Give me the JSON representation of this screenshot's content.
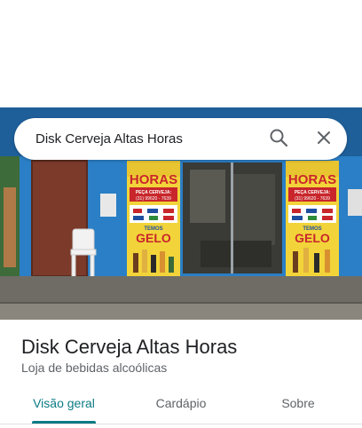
{
  "search": {
    "query": "Disk Cerveja Altas Horas"
  },
  "photo": {
    "sign_left": {
      "headline": "HORAS",
      "call_label": "PEÇA CERVEJA:",
      "phone": "(31) 99620 - 7639",
      "temos": "TEMOS",
      "gelo": "GELO"
    },
    "sign_right": {
      "headline": "HORAS",
      "call_label": "PEÇA CERVEJA:",
      "phone": "(31) 99620 - 7639",
      "temos": "TEMOS",
      "gelo": "GELO"
    },
    "colors": {
      "wall": "#2a7fc6",
      "sign_yellow": "#f2d43a",
      "sign_red": "#c8262b"
    }
  },
  "place": {
    "name": "Disk Cerveja Altas Horas",
    "category": "Loja de bebidas alcoólicas"
  },
  "tabs": [
    {
      "label": "Visão geral",
      "active": true
    },
    {
      "label": "Cardápio",
      "active": false
    },
    {
      "label": "Sobre",
      "active": false
    }
  ],
  "icons": {
    "search": "search-icon",
    "close": "close-icon"
  },
  "colors": {
    "accent": "#0b7b85",
    "muted": "#5f6368",
    "text": "#202124"
  }
}
